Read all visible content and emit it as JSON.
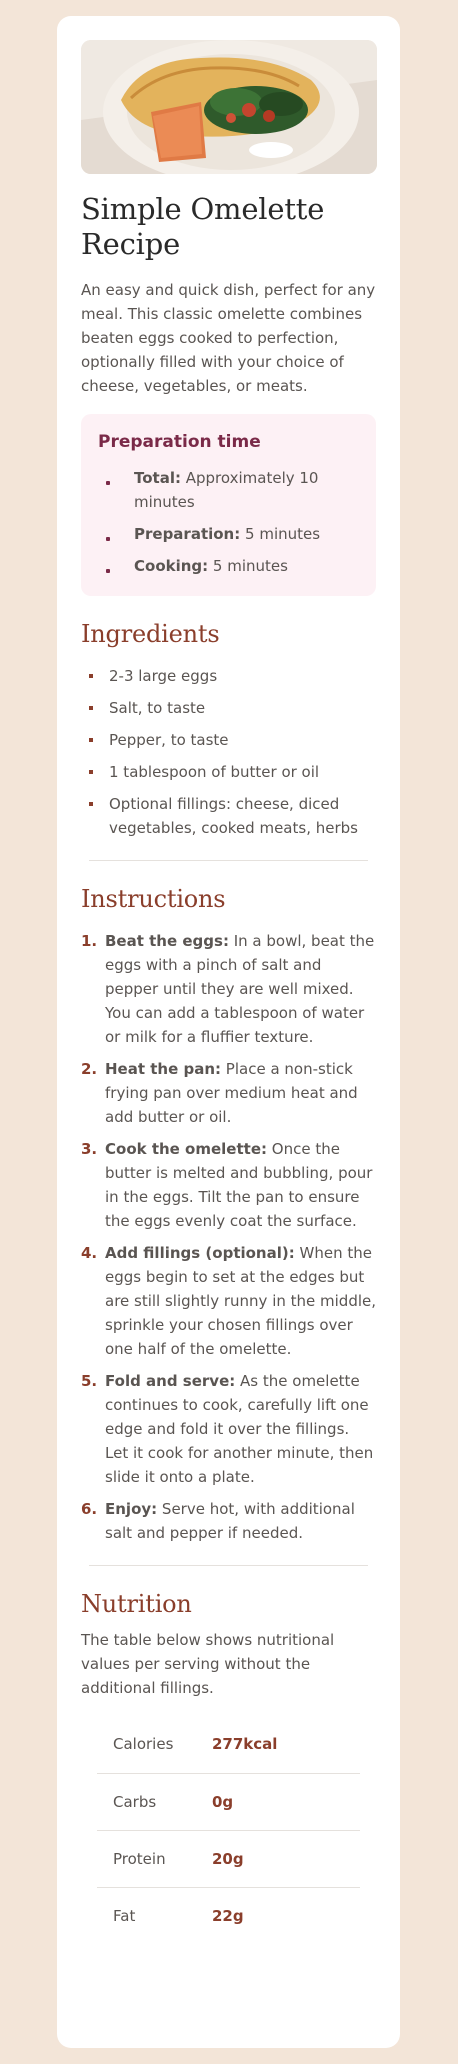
{
  "recipe": {
    "title": "Simple Omelette Recipe",
    "description": "An easy and quick dish, perfect for any meal. This classic omelette combines beaten eggs cooked to perfection, optionally filled with your choice of cheese, vegetables, or meats."
  },
  "preparation": {
    "heading": "Preparation time",
    "items": [
      {
        "label": "Total:",
        "value": " Approximately 10 minutes"
      },
      {
        "label": "Preparation:",
        "value": " 5 minutes"
      },
      {
        "label": "Cooking:",
        "value": " 5 minutes"
      }
    ]
  },
  "ingredients": {
    "heading": "Ingredients",
    "items": [
      "2-3 large eggs",
      "Salt, to taste",
      "Pepper, to taste",
      "1 tablespoon of butter or oil",
      "Optional fillings: cheese, diced vegetables, cooked meats, herbs"
    ]
  },
  "instructions": {
    "heading": "Instructions",
    "steps": [
      {
        "num": "1.",
        "label": "Beat the eggs:",
        "text": " In a bowl, beat the eggs with a pinch of salt and pepper until they are well mixed. You can add a tablespoon of water or milk for a fluffier texture."
      },
      {
        "num": "2.",
        "label": "Heat the pan:",
        "text": " Place a non-stick frying pan over medium heat and add butter or oil."
      },
      {
        "num": "3.",
        "label": "Cook the omelette:",
        "text": " Once the butter is melted and bubbling, pour in the eggs. Tilt the pan to ensure the eggs evenly coat the surface."
      },
      {
        "num": "4.",
        "label": "Add fillings (optional):",
        "text": " When the eggs begin to set at the edges but are still slightly runny in the middle, sprinkle your chosen fillings over one half of the omelette."
      },
      {
        "num": "5.",
        "label": "Fold and serve:",
        "text": " As the omelette continues to cook, carefully lift one edge and fold it over the fillings. Let it cook for another minute, then slide it onto a plate."
      },
      {
        "num": "6.",
        "label": "Enjoy:",
        "text": " Serve hot, with additional salt and pepper if needed."
      }
    ]
  },
  "nutrition": {
    "heading": "Nutrition",
    "description": "The table below shows nutritional values per serving without the additional fillings.",
    "rows": [
      {
        "name": "Calories",
        "value": "277kcal"
      },
      {
        "name": "Carbs",
        "value": "0g"
      },
      {
        "name": "Protein",
        "value": "20g"
      },
      {
        "name": "Fat",
        "value": "22g"
      }
    ]
  },
  "colors": {
    "page_bg": "#f3e5d8",
    "accent_brown": "#8a3e2b",
    "accent_rose": "#7a2a48",
    "prep_bg": "#fdf1f5"
  }
}
